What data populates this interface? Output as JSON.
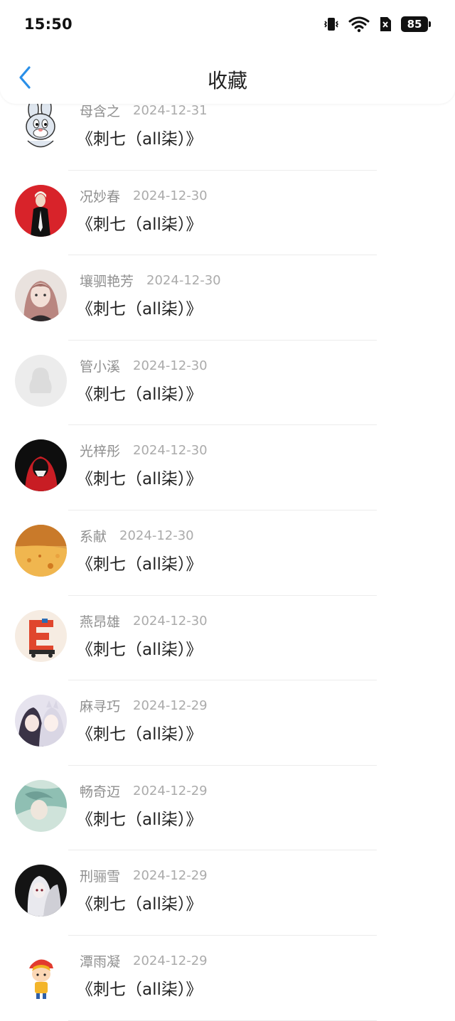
{
  "status_bar": {
    "time": "15:50",
    "battery": "85"
  },
  "header": {
    "title": "收藏"
  },
  "items": [
    {
      "name": "母含之",
      "date": "2024-12-31",
      "book": "《刺七（all柒）》",
      "avatar": "cartoon-rabbit"
    },
    {
      "name": "况妙春",
      "date": "2024-12-30",
      "book": "《刺七（all柒）》",
      "avatar": "red-figure"
    },
    {
      "name": "壤驷艳芳",
      "date": "2024-12-30",
      "book": "《刺七（all柒）》",
      "avatar": "girl-portrait"
    },
    {
      "name": "管小溪",
      "date": "2024-12-30",
      "book": "《刺七（all柒）》",
      "avatar": "default-penguin"
    },
    {
      "name": "光梓彤",
      "date": "2024-12-30",
      "book": "《刺七（all柒）》",
      "avatar": "red-hood"
    },
    {
      "name": "系献",
      "date": "2024-12-30",
      "book": "《刺七（all柒）》",
      "avatar": "autumn-leaves"
    },
    {
      "name": "燕昂雄",
      "date": "2024-12-30",
      "book": "《刺七（all柒）》",
      "avatar": "letter-e-art"
    },
    {
      "name": "麻寻巧",
      "date": "2024-12-29",
      "book": "《刺七（all柒）》",
      "avatar": "anime-pair"
    },
    {
      "name": "畅奇迈",
      "date": "2024-12-29",
      "book": "《刺七（all柒）》",
      "avatar": "teal-painting"
    },
    {
      "name": "刑骊雪",
      "date": "2024-12-29",
      "book": "《刺七（all柒）》",
      "avatar": "white-hair-anime"
    },
    {
      "name": "潭雨凝",
      "date": "2024-12-29",
      "book": "《刺七（all柒）》",
      "avatar": "cartoon-kid"
    }
  ]
}
